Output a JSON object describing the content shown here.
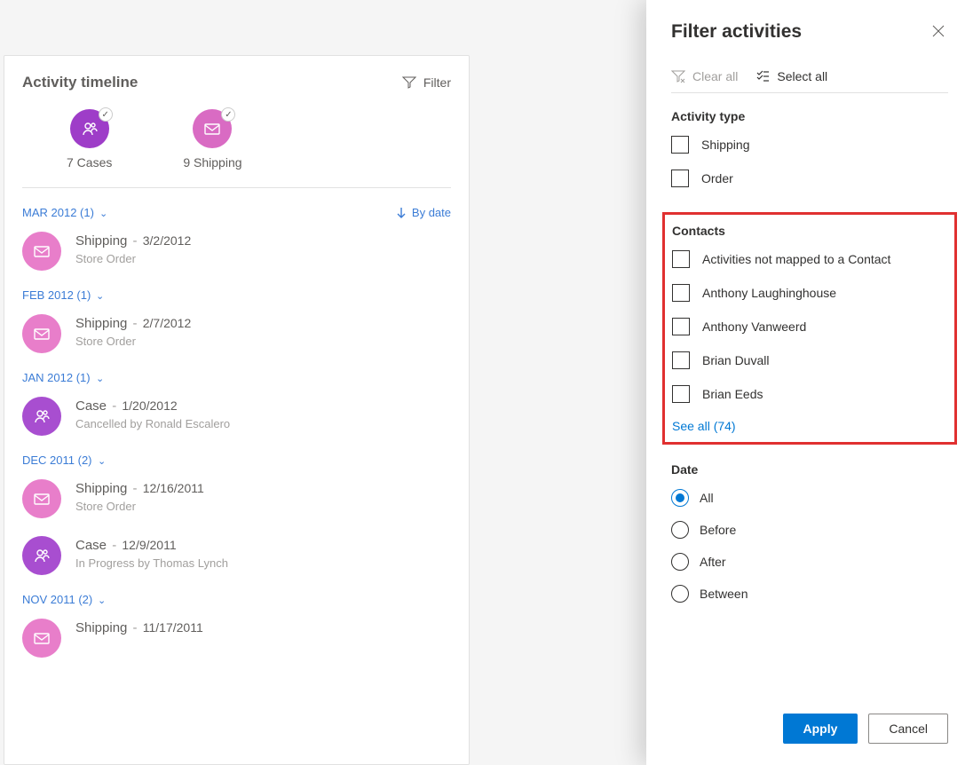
{
  "timeline": {
    "title": "Activity timeline",
    "filter_label": "Filter",
    "summary": [
      {
        "icon": "person",
        "color": "purple",
        "label": "7 Cases"
      },
      {
        "icon": "mail",
        "color": "pink",
        "label": "9 Shipping"
      }
    ],
    "by_date_label": "By date",
    "groups": [
      {
        "header": "MAR 2012 (1)",
        "items": [
          {
            "icon": "mail",
            "color": "pink",
            "title": "Shipping",
            "date": "3/2/2012",
            "sub": "Store Order"
          }
        ]
      },
      {
        "header": "FEB 2012 (1)",
        "items": [
          {
            "icon": "mail",
            "color": "pink",
            "title": "Shipping",
            "date": "2/7/2012",
            "sub": "Store Order"
          }
        ]
      },
      {
        "header": "JAN 2012 (1)",
        "items": [
          {
            "icon": "person",
            "color": "purple",
            "title": "Case",
            "date": "1/20/2012",
            "sub": "Cancelled by Ronald Escalero"
          }
        ]
      },
      {
        "header": "DEC 2011 (2)",
        "items": [
          {
            "icon": "mail",
            "color": "pink",
            "title": "Shipping",
            "date": "12/16/2011",
            "sub": "Store Order"
          },
          {
            "icon": "person",
            "color": "purple",
            "title": "Case",
            "date": "12/9/2011",
            "sub": "In Progress by Thomas Lynch"
          }
        ]
      },
      {
        "header": "NOV 2011 (2)",
        "items": [
          {
            "icon": "mail",
            "color": "pink",
            "title": "Shipping",
            "date": "11/17/2011",
            "sub": ""
          }
        ]
      }
    ]
  },
  "panel": {
    "title": "Filter activities",
    "clear_all": "Clear all",
    "select_all": "Select all",
    "activity_type_title": "Activity type",
    "activity_types": [
      "Shipping",
      "Order"
    ],
    "contacts_title": "Contacts",
    "contacts": [
      "Activities not mapped to a Contact",
      "Anthony Laughinghouse",
      "Anthony Vanweerd",
      "Brian Duvall",
      "Brian Eeds"
    ],
    "see_all": "See all (74)",
    "date_title": "Date",
    "date_options": [
      "All",
      "Before",
      "After",
      "Between"
    ],
    "date_selected": 0,
    "apply": "Apply",
    "cancel": "Cancel"
  }
}
